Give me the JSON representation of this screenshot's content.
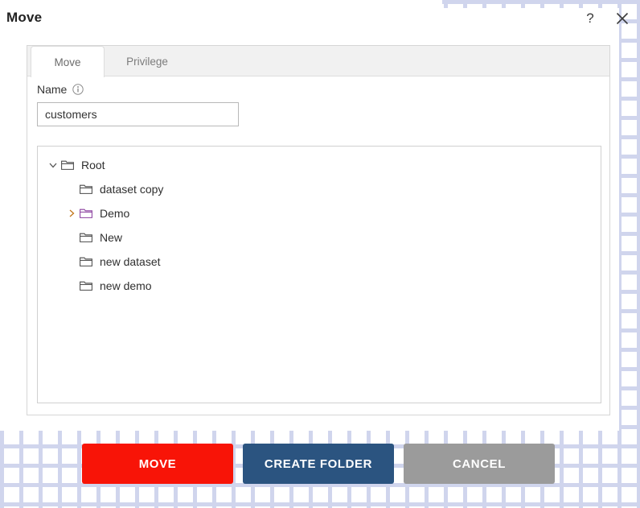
{
  "header": {
    "title": "Move",
    "help_icon": "question-mark-icon",
    "close_icon": "close-icon"
  },
  "tabs": [
    {
      "id": "move",
      "label": "Move",
      "active": true
    },
    {
      "id": "privilege",
      "label": "Privilege",
      "active": false
    }
  ],
  "form": {
    "name_label": "Name",
    "info_icon": "info-icon",
    "name_value": "customers",
    "name_placeholder": "customers"
  },
  "tree": {
    "nodes": [
      {
        "label": "Root",
        "depth": 0,
        "twisty": "expanded",
        "icon": "folder-icon",
        "selected": false
      },
      {
        "label": "dataset copy",
        "depth": 1,
        "twisty": "none",
        "icon": "folder-icon",
        "selected": false
      },
      {
        "label": "Demo",
        "depth": 1,
        "twisty": "collapsed",
        "icon": "folder-icon-selected",
        "selected": true
      },
      {
        "label": "New",
        "depth": 1,
        "twisty": "none",
        "icon": "folder-icon",
        "selected": false
      },
      {
        "label": "new dataset",
        "depth": 1,
        "twisty": "none",
        "icon": "folder-icon",
        "selected": false
      },
      {
        "label": "new demo",
        "depth": 1,
        "twisty": "none",
        "icon": "folder-icon",
        "selected": false
      }
    ]
  },
  "footer": {
    "move_label": "MOVE",
    "create_folder_label": "CREATE FOLDER",
    "cancel_label": "CANCEL"
  },
  "colors": {
    "move_button": "#f81407",
    "create_folder_button": "#2b5480",
    "cancel_button": "#9b9b9b",
    "pattern_dot": "#aab4e0",
    "selected_folder_outline": "#8a3f9e",
    "selected_twisty": "#c2761a"
  }
}
